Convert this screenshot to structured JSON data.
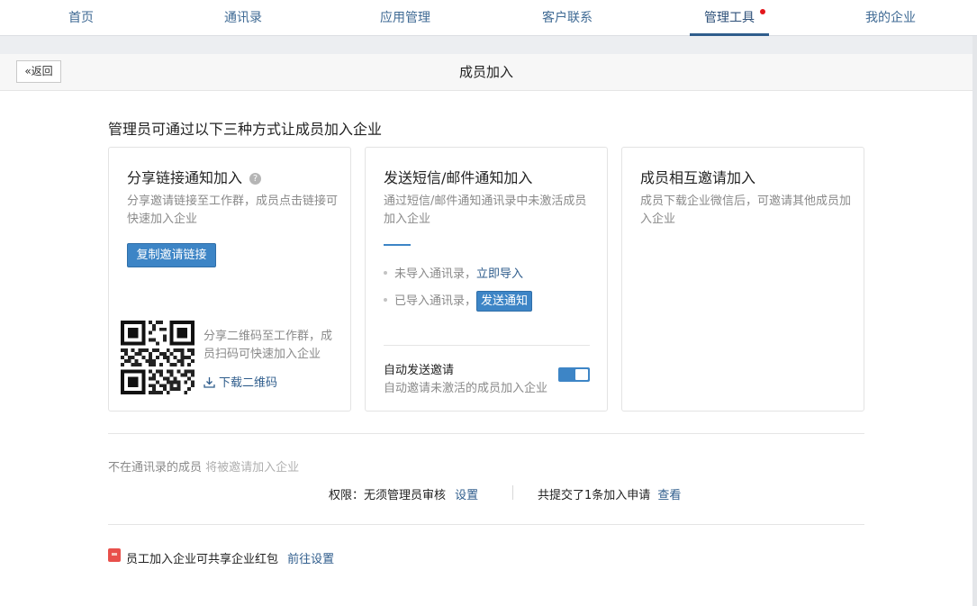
{
  "nav": {
    "items": [
      {
        "label": "首页"
      },
      {
        "label": "通讯录"
      },
      {
        "label": "应用管理"
      },
      {
        "label": "客户联系"
      },
      {
        "label": "管理工具"
      },
      {
        "label": "我的企业"
      }
    ],
    "active_index": 4,
    "notification_dot_color": "#e3161b"
  },
  "header": {
    "back_label": "返回",
    "title": "成员加入"
  },
  "intro": "管理员可通过以下三种方式让成员加入企业",
  "cards": [
    {
      "title": "分享链接通知加入",
      "desc": "分享邀请链接至工作群，成员点击链接可快速加入企业",
      "button_label": "复制邀请链接",
      "qr_text": "分享二维码至工作群，成员扫码可快速加入企业",
      "download_label": "下载二维码"
    },
    {
      "title": "发送短信/邮件通知加入",
      "desc": "通过短信/邮件通知通讯录中未激活成员加入企业",
      "row1_text": "未导入通讯录，",
      "row1_link": "立即导入",
      "row2_text": "已导入通讯录，",
      "row2_button": "发送通知",
      "auto_title": "自动发送邀请",
      "auto_desc": "自动邀请未激活的成员加入企业",
      "auto_enabled": true
    },
    {
      "title": "成员相互邀请加入",
      "desc": "成员下载企业微信后，可邀请其他成员加入企业"
    }
  ],
  "footer": {
    "faded_text_1": "不在通讯录的成员",
    "faded_text_2": "将被邀请加入企业",
    "perm_text": "权限：无须管理员审核",
    "perm_link": "设置",
    "apply_text": "共提交了1条加入申请",
    "apply_link": "查看",
    "redpacket_text": "员工加入企业可共享企业红包",
    "redpacket_link": "前往设置"
  },
  "colors": {
    "accent": "#3d85c6",
    "link": "#2f5d8c",
    "redpacket": "#e8504b"
  }
}
